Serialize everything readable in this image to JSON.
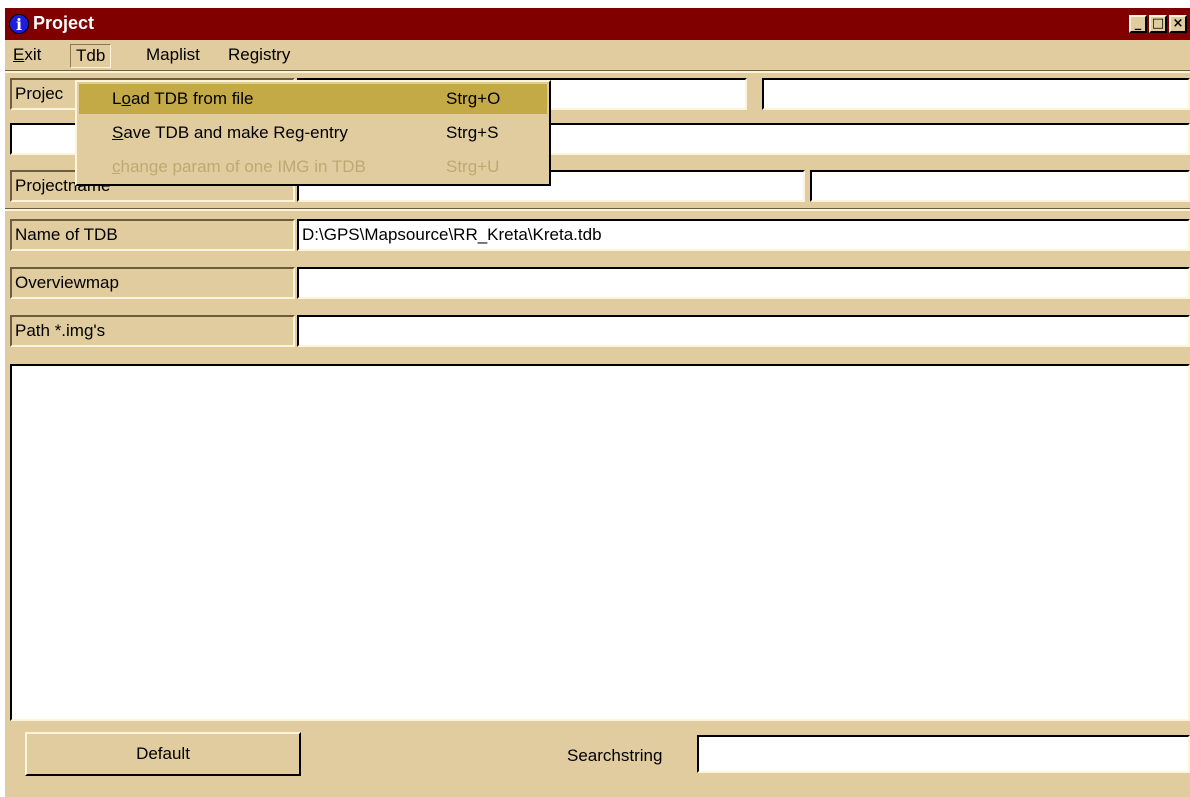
{
  "window": {
    "title": "Project"
  },
  "menubar": {
    "items": [
      {
        "label_u": "E",
        "label_rest": "xit"
      },
      {
        "label": "Tdb"
      },
      {
        "label": "Maplist"
      },
      {
        "label": "Registry"
      }
    ]
  },
  "tdb_menu": {
    "items": [
      {
        "pre": "L",
        "u": "o",
        "post": "ad TDB from file",
        "accel": "Strg+O",
        "state": "highlighted"
      },
      {
        "pre": "",
        "u": "S",
        "post": "ave TDB and make Reg-entry",
        "accel": "Strg+S",
        "state": "enabled"
      },
      {
        "pre": "",
        "u": "c",
        "post": "hange param of one IMG in TDB",
        "accel": "Strg+U",
        "state": "disabled"
      }
    ]
  },
  "rows": {
    "row1": {
      "label": "Projec",
      "value_a": "",
      "value_b": ""
    },
    "row2": {
      "value": ""
    },
    "projectname": {
      "label": "Projectname",
      "value_a": "",
      "value_b": ""
    },
    "name_of_tdb": {
      "label": "Name of TDB",
      "value": "D:\\GPS\\Mapsource\\RR_Kreta\\Kreta.tdb"
    },
    "overviewmap": {
      "label": "Overviewmap",
      "value": ""
    },
    "path_imgs": {
      "label": "Path *.img's",
      "value": ""
    }
  },
  "footer": {
    "default_button": "Default",
    "search_label": "Searchstring",
    "search_value": ""
  },
  "colors": {
    "titlebar": "#800000",
    "window_bg": "#e0cc9e",
    "menu_highlight": "#c4aa46",
    "disabled_text": "#bfa972"
  }
}
